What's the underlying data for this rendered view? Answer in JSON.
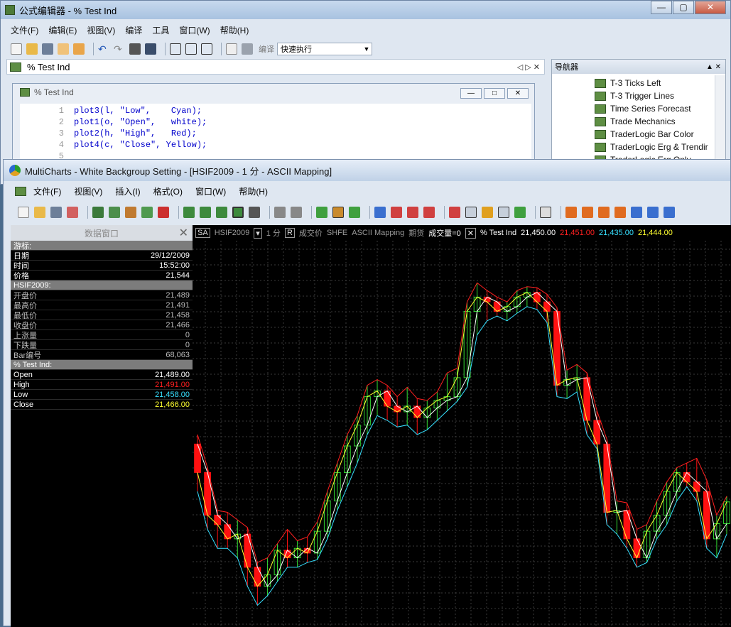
{
  "editor": {
    "title": "公式编辑器 - % Test Ind",
    "window_controls": [
      "—",
      "▢",
      "✕"
    ],
    "menu": [
      "文件(F)",
      "编辑(E)",
      "视图(V)",
      "编译",
      "工具",
      "窗口(W)",
      "帮助(H)"
    ],
    "compile_label": "编译",
    "exec_combo": "快速执行",
    "tab_label": "% Test Ind",
    "tab_nav": "◁ ▷ ✕",
    "doc_title": "% Test Ind",
    "doc_controls": [
      "—",
      "□",
      "✕"
    ],
    "code_lines": [
      {
        "num": "1",
        "text": "plot3(l, \"Low\",    Cyan);"
      },
      {
        "num": "2",
        "text": "plot1(o, \"Open\",   white);"
      },
      {
        "num": "3",
        "text": "plot2(h, \"High\",   Red);"
      },
      {
        "num": "4",
        "text": "plot4(c, \"Close\", Yellow);"
      },
      {
        "num": "5",
        "text": ""
      }
    ]
  },
  "navigator": {
    "title": "导航器",
    "controls": "▲ ✕",
    "items": [
      "T-3 Ticks Left",
      "T-3 Trigger Lines",
      "Time Series Forecast",
      "Trade Mechanics",
      "TraderLogic Bar Color",
      "TraderLogic Erg & Trendir",
      "TraderLogic Erg Only"
    ]
  },
  "multicharts": {
    "title": "MultiCharts - White Backgroup Setting - [HSIF2009 - 1 分 - ASCII Mapping]",
    "window_controls": [
      "—",
      "▢",
      "✕"
    ],
    "menu": [
      "文件(F)",
      "视图(V)",
      "插入(I)",
      "格式(O)",
      "窗口(W)",
      "帮助(H)"
    ]
  },
  "data_window": {
    "title": "数据窗口",
    "sections": [
      {
        "header": "游标:",
        "rows": [
          {
            "label": "日期",
            "value": "29/12/2009"
          },
          {
            "label": "时间",
            "value": "15:52:00"
          },
          {
            "label": "价格",
            "value": "21,544"
          }
        ]
      },
      {
        "header": "HSIF2009:",
        "dim": true,
        "rows": [
          {
            "label": "开盘价",
            "value": "21,489"
          },
          {
            "label": "最高价",
            "value": "21,491"
          },
          {
            "label": "最低价",
            "value": "21,458"
          },
          {
            "label": "收盘价",
            "value": "21,466"
          },
          {
            "label": "上涨量",
            "value": "0"
          },
          {
            "label": "下跌量",
            "value": "0"
          },
          {
            "label": "Bar编号",
            "value": "68,063"
          }
        ]
      },
      {
        "header": "% Test Ind:",
        "rows": [
          {
            "label": "Open",
            "value": "21,489.00",
            "color": "#ffffff"
          },
          {
            "label": "High",
            "value": "21,491.00",
            "color": "#ff2020"
          },
          {
            "label": "Low",
            "value": "21,458.00",
            "color": "#37e0ff"
          },
          {
            "label": "Close",
            "value": "21,466.00",
            "color": "#ffff30"
          }
        ]
      }
    ]
  },
  "chart_header": {
    "sa": "SA",
    "symbol": "HSIF2009",
    "interval": "1 分",
    "r": "R",
    "exchange_label": "成交价",
    "exchange": "SHFE",
    "mapping": "ASCII Mapping",
    "category": "期货",
    "volume": "成交量=0",
    "x": "✕",
    "indicator": "% Test Ind",
    "open": "21,450.00",
    "high": "21,451.00",
    "low": "21,435.00",
    "close": "21,444.00"
  },
  "colors": {
    "open": "#ffffff",
    "high": "#ff2020",
    "low": "#37e0ff",
    "close": "#ffff30",
    "up_body": "#33dd33",
    "down_body": "#ff1010"
  },
  "chart_data": {
    "type": "candlestick",
    "series": [
      {
        "o": 21550,
        "h": 21560,
        "l": 21500,
        "c": 21520
      },
      {
        "o": 21520,
        "h": 21525,
        "l": 21460,
        "c": 21475
      },
      {
        "o": 21475,
        "h": 21480,
        "l": 21440,
        "c": 21465
      },
      {
        "o": 21465,
        "h": 21478,
        "l": 21440,
        "c": 21450
      },
      {
        "o": 21450,
        "h": 21470,
        "l": 21430,
        "c": 21455
      },
      {
        "o": 21455,
        "h": 21462,
        "l": 21400,
        "c": 21420
      },
      {
        "o": 21420,
        "h": 21425,
        "l": 21380,
        "c": 21400
      },
      {
        "o": 21400,
        "h": 21430,
        "l": 21390,
        "c": 21412
      },
      {
        "o": 21412,
        "h": 21445,
        "l": 21405,
        "c": 21438
      },
      {
        "o": 21438,
        "h": 21460,
        "l": 21420,
        "c": 21430
      },
      {
        "o": 21430,
        "h": 21448,
        "l": 21420,
        "c": 21440
      },
      {
        "o": 21440,
        "h": 21452,
        "l": 21425,
        "c": 21435
      },
      {
        "o": 21435,
        "h": 21468,
        "l": 21428,
        "c": 21458
      },
      {
        "o": 21458,
        "h": 21500,
        "l": 21450,
        "c": 21490
      },
      {
        "o": 21490,
        "h": 21530,
        "l": 21480,
        "c": 21520
      },
      {
        "o": 21520,
        "h": 21560,
        "l": 21505,
        "c": 21548
      },
      {
        "o": 21548,
        "h": 21580,
        "l": 21530,
        "c": 21570
      },
      {
        "o": 21570,
        "h": 21612,
        "l": 21560,
        "c": 21600
      },
      {
        "o": 21600,
        "h": 21618,
        "l": 21580,
        "c": 21606
      },
      {
        "o": 21606,
        "h": 21612,
        "l": 21575,
        "c": 21590
      },
      {
        "o": 21590,
        "h": 21600,
        "l": 21568,
        "c": 21584
      },
      {
        "o": 21584,
        "h": 21610,
        "l": 21570,
        "c": 21590
      },
      {
        "o": 21590,
        "h": 21598,
        "l": 21560,
        "c": 21578
      },
      {
        "o": 21578,
        "h": 21596,
        "l": 21565,
        "c": 21588
      },
      {
        "o": 21588,
        "h": 21605,
        "l": 21575,
        "c": 21596
      },
      {
        "o": 21596,
        "h": 21625,
        "l": 21585,
        "c": 21600
      },
      {
        "o": 21600,
        "h": 21630,
        "l": 21595,
        "c": 21620
      },
      {
        "o": 21620,
        "h": 21700,
        "l": 21610,
        "c": 21690
      },
      {
        "o": 21690,
        "h": 21720,
        "l": 21665,
        "c": 21705
      },
      {
        "o": 21705,
        "h": 21712,
        "l": 21680,
        "c": 21700
      },
      {
        "o": 21700,
        "h": 21705,
        "l": 21685,
        "c": 21690
      },
      {
        "o": 21690,
        "h": 21700,
        "l": 21680,
        "c": 21695
      },
      {
        "o": 21695,
        "h": 21712,
        "l": 21688,
        "c": 21705
      },
      {
        "o": 21705,
        "h": 21716,
        "l": 21695,
        "c": 21710
      },
      {
        "o": 21710,
        "h": 21715,
        "l": 21692,
        "c": 21700
      },
      {
        "o": 21700,
        "h": 21708,
        "l": 21678,
        "c": 21690
      },
      {
        "o": 21690,
        "h": 21694,
        "l": 21600,
        "c": 21612
      },
      {
        "o": 21612,
        "h": 21628,
        "l": 21598,
        "c": 21618
      },
      {
        "o": 21618,
        "h": 21634,
        "l": 21605,
        "c": 21620
      },
      {
        "o": 21620,
        "h": 21625,
        "l": 21560,
        "c": 21575
      },
      {
        "o": 21575,
        "h": 21585,
        "l": 21545,
        "c": 21550
      },
      {
        "o": 21550,
        "h": 21555,
        "l": 21465,
        "c": 21478
      },
      {
        "o": 21478,
        "h": 21490,
        "l": 21455,
        "c": 21480
      },
      {
        "o": 21480,
        "h": 21488,
        "l": 21440,
        "c": 21450
      },
      {
        "o": 21450,
        "h": 21460,
        "l": 21420,
        "c": 21430
      },
      {
        "o": 21430,
        "h": 21465,
        "l": 21425,
        "c": 21458
      },
      {
        "o": 21458,
        "h": 21490,
        "l": 21450,
        "c": 21475
      },
      {
        "o": 21475,
        "h": 21510,
        "l": 21465,
        "c": 21500
      },
      {
        "o": 21500,
        "h": 21525,
        "l": 21490,
        "c": 21520
      },
      {
        "o": 21520,
        "h": 21530,
        "l": 21505,
        "c": 21510
      },
      {
        "o": 21510,
        "h": 21535,
        "l": 21490,
        "c": 21500
      },
      {
        "o": 21500,
        "h": 21512,
        "l": 21440,
        "c": 21450
      },
      {
        "o": 21450,
        "h": 21475,
        "l": 21430,
        "c": 21466
      },
      {
        "o": 21466,
        "h": 21495,
        "l": 21455,
        "c": 21489
      }
    ],
    "ylim": [
      21360,
      21760
    ]
  }
}
